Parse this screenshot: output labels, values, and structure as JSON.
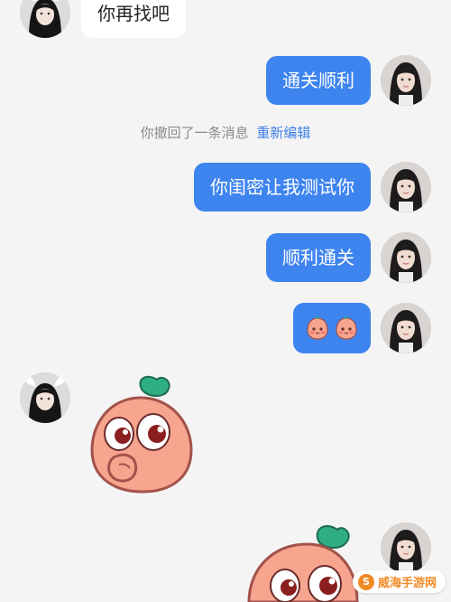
{
  "chat": {
    "messages": [
      {
        "sender": "contact",
        "type": "text",
        "text": "你再找吧"
      },
      {
        "sender": "self",
        "type": "text",
        "text": "通关顺利"
      },
      {
        "sender": "self",
        "type": "text",
        "text": "你闺密让我测试你"
      },
      {
        "sender": "self",
        "type": "text",
        "text": "顺利通关"
      },
      {
        "sender": "self",
        "type": "emoji",
        "emoji_icons": [
          "peach-blush-emoji",
          "peach-blush-emoji"
        ]
      },
      {
        "sender": "contact",
        "type": "sticker",
        "sticker_icon": "peach-mascot-thinking-sticker"
      },
      {
        "sender": "self",
        "type": "sticker",
        "sticker_icon": "peach-mascot-sticker"
      }
    ],
    "recall_notice": {
      "text": "你撤回了一条消息",
      "action": "重新编辑"
    }
  },
  "colors": {
    "background": "#f4f4f4",
    "outgoing_bubble": "#3e84ef",
    "incoming_bubble": "#ffffff",
    "notice_text": "#8a8a8a",
    "link": "#3e7fe6",
    "peach": "#f7a58f",
    "sprout": "#2fae83"
  },
  "watermark": {
    "text": "威海手游网",
    "logo_icon": "watermark-logo-icon"
  }
}
